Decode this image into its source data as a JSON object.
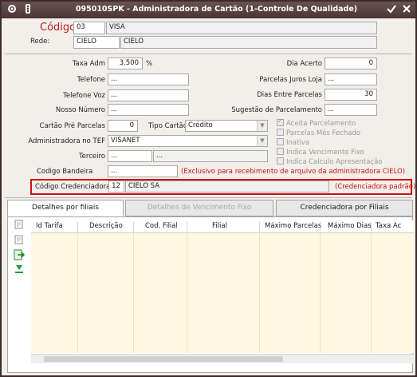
{
  "window": {
    "title": "095010SPK - Administradora de Cartão (1-Controle De Qualidade)"
  },
  "header": {
    "codigo_label": "Código",
    "codigo_value": "03",
    "codigo_desc": "VISA",
    "rede_label": "Rede:",
    "rede_code": "CIELO",
    "rede_desc": "CIELO"
  },
  "left": {
    "taxa_adm_label": "Taxa Adm",
    "taxa_adm_value": "3.500",
    "taxa_adm_unit": "%",
    "telefone_label": "Telefone",
    "telefone_value": "...",
    "telefone_voz_label": "Telefone Voz",
    "telefone_voz_value": "...",
    "nosso_numero_label": "Nosso Número",
    "nosso_numero_value": "...",
    "cartao_pre_label": "Cartão Pré Parcelas",
    "cartao_pre_value": "0",
    "tipo_cartao_label": "Tipo Cartão",
    "tipo_cartao_value": "Crédito",
    "adm_tef_label": "Administradora no TEF",
    "adm_tef_value": "VISANET",
    "terceiro_label": "Terceiro",
    "terceiro_code": "...",
    "terceiro_desc": "...",
    "bandeira_label": "Codigo Bandeira",
    "bandeira_value": "...",
    "bandeira_note": "(Exclusivo para recebimento de arquivo da administradora CIELO)"
  },
  "right": {
    "dia_acerto_label": "Dia Acerto",
    "dia_acerto_value": "0",
    "parcelas_juros_label": "Parcelas Juros Loja",
    "parcelas_juros_value": "...",
    "dias_entre_label": "Dias Entre Parcelas",
    "dias_entre_value": "30",
    "sugestao_label": "Sugestão de Parcelamento",
    "sugestao_value": "..."
  },
  "checkboxes": {
    "aceita": "Aceita Parcelamento",
    "parcelas_mes": "Parcelas Mês Fechado",
    "inativa": "Inativa",
    "indica_venc": "Indica Vencimento Fixo",
    "indica_calc": "Indica Calculo Apresentação"
  },
  "credenciadora": {
    "label": "Código Credenciadora",
    "code": "12",
    "name": "CIELO SA",
    "note": "(Credenciadora padrão)"
  },
  "tabs": {
    "detalhes": "Detalhes por filiais",
    "vencimento": "Detalhes de Vencimento Fixo",
    "credenciadora": "Credenciadora por Filiais"
  },
  "grid": {
    "columns": [
      "Id Tarifa",
      "Descrição",
      "Cod. Filial",
      "Filial",
      "Máximo Parcelas",
      "Máximo Dias",
      "Taxa Ac"
    ]
  },
  "icons": {
    "toolbar": [
      "settings-icon",
      "traffic-light-icon",
      "check-icon",
      "close-icon"
    ],
    "grid_side": [
      "add-row-icon",
      "remove-row-icon",
      "export-icon",
      "download-icon"
    ]
  },
  "colors": {
    "highlight_border": "#cc1111",
    "grid_background": "#fdf8df",
    "titlebar": "#5a4040"
  }
}
